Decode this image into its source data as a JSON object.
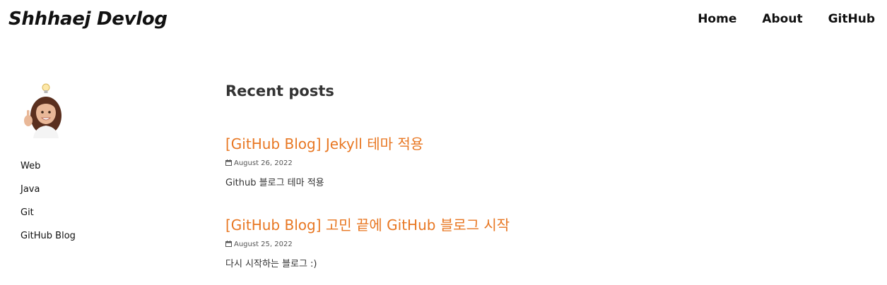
{
  "header": {
    "brand": "Shhhaej Devlog",
    "nav": [
      "Home",
      "About",
      "GitHub"
    ]
  },
  "sidebar": {
    "avatar_icon": "memoji-avatar-icon",
    "categories": [
      "Web",
      "Java",
      "Git",
      "GitHub Blog"
    ]
  },
  "main": {
    "section_title": "Recent posts",
    "posts": [
      {
        "title": "[GitHub Blog] Jekyll 테마 적용",
        "date": "August 26, 2022",
        "excerpt": "Github 블로그 테마 적용"
      },
      {
        "title": "[GitHub Blog] 고민 끝에 GitHub 블로그 시작",
        "date": "August 25, 2022",
        "excerpt": "다시 시작하는 블로그 :)"
      }
    ]
  },
  "colors": {
    "accent": "#e87722",
    "text": "#333333",
    "brand": "#111111"
  }
}
